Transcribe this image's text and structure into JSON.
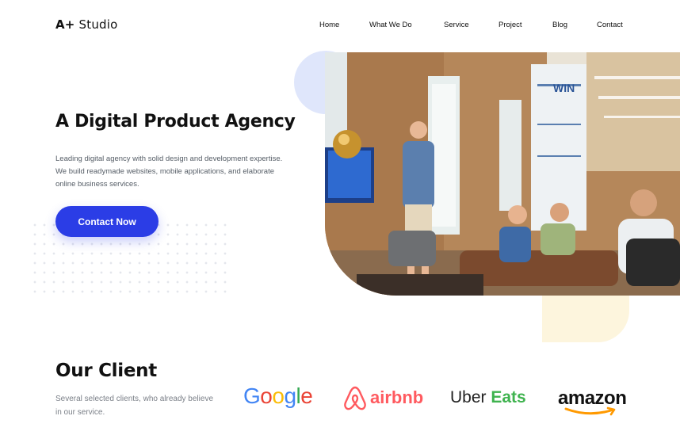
{
  "header": {
    "logo_mark": "A+",
    "logo_word": "Studio",
    "nav": [
      "Home",
      "What We Do",
      "Service",
      "Project",
      "Blog",
      "Contact"
    ]
  },
  "hero": {
    "title": "A Digital Product Agency",
    "description": "Leading digital agency with solid design and development expertise. We build readymade websites, mobile applications, and elaborate online business services.",
    "cta_label": "Contact Now"
  },
  "clients": {
    "title": "Our Client",
    "description": "Several selected clients, who already believe in our service.",
    "logos": {
      "google": [
        "G",
        "o",
        "o",
        "g",
        "l",
        "e"
      ],
      "airbnb": "airbnb",
      "uber": "Uber",
      "eats": "Eats",
      "amazon": "amazon"
    }
  },
  "photo_sign": "WIN",
  "colors": {
    "accent": "#2b3de6",
    "soft_blue": "#dfe6fb",
    "soft_yellow": "#fdf5dd",
    "google": [
      "#4285f4",
      "#ea4335",
      "#fbbc05",
      "#4285f4",
      "#34a853",
      "#ea4335"
    ],
    "airbnb": "#ff5a5f",
    "eats": "#3fb34f",
    "amazon_smile": "#ff9900"
  }
}
